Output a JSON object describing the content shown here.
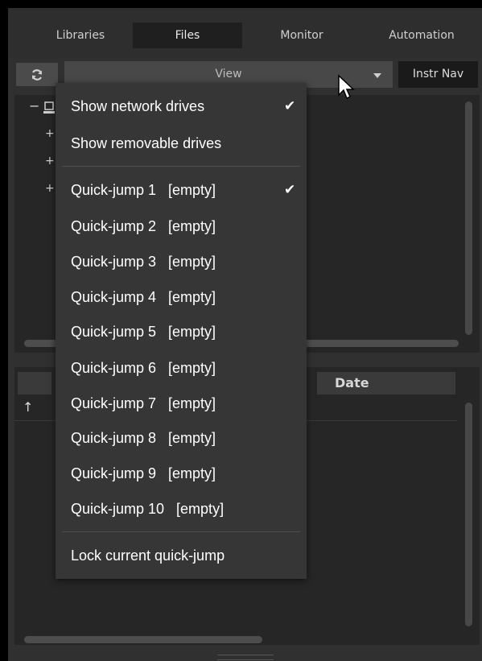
{
  "tabs": [
    {
      "label": "Libraries"
    },
    {
      "label": "Files"
    },
    {
      "label": "Monitor"
    },
    {
      "label": "Automation"
    }
  ],
  "toolbar": {
    "refresh_icon": "refresh-icon",
    "view_label": "View",
    "instr_nav_label": "Instr Nav"
  },
  "tree": {
    "expanders": [
      "−",
      "+",
      "+",
      "+"
    ],
    "computer_icon": "computer-icon"
  },
  "file_list": {
    "date_header": "Date",
    "up_arrow": "↑"
  },
  "menu": {
    "items": [
      {
        "label": "Show network drives",
        "checked": "✔"
      },
      {
        "label": "Show removable drives",
        "checked": ""
      },
      {
        "label": "Quick-jump 1   [empty]",
        "checked": "✔"
      },
      {
        "label": "Quick-jump 2   [empty]",
        "checked": ""
      },
      {
        "label": "Quick-jump 3   [empty]",
        "checked": ""
      },
      {
        "label": "Quick-jump 4   [empty]",
        "checked": ""
      },
      {
        "label": "Quick-jump 5   [empty]",
        "checked": ""
      },
      {
        "label": "Quick-jump 6   [empty]",
        "checked": ""
      },
      {
        "label": "Quick-jump 7   [empty]",
        "checked": ""
      },
      {
        "label": "Quick-jump 8   [empty]",
        "checked": ""
      },
      {
        "label": "Quick-jump 9   [empty]",
        "checked": ""
      },
      {
        "label": "Quick-jump 10   [empty]",
        "checked": ""
      },
      {
        "label": "Lock current quick-jump",
        "checked": ""
      }
    ]
  }
}
